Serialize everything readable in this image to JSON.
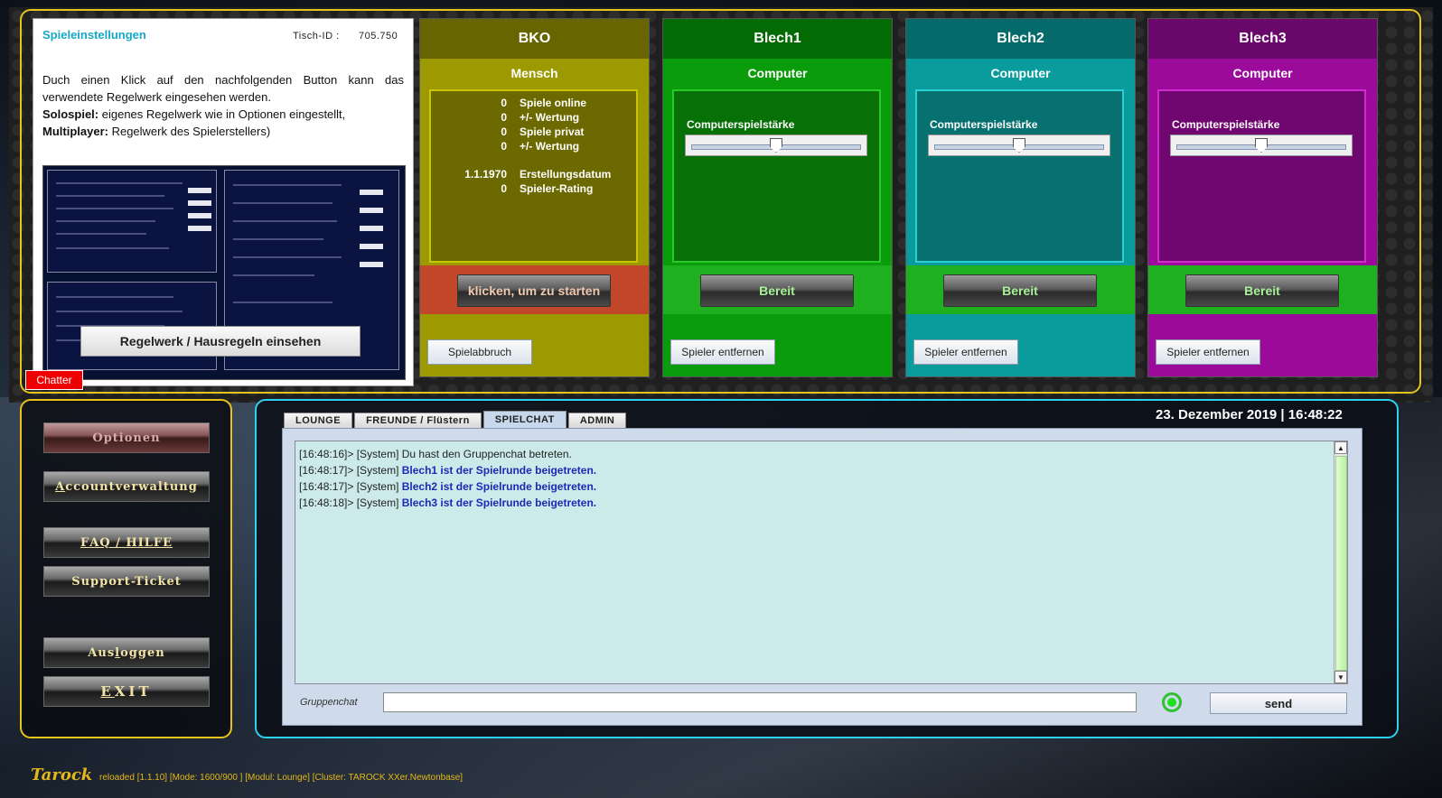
{
  "settings": {
    "title": "Spieleinstellungen",
    "tisch_label": "Tisch-ID :",
    "tisch_id": "705.750",
    "desc_1": "Duch einen Klick auf den nachfolgenden Button kann das verwendete Regelwerk eingesehen werden.",
    "solo_label": "Solospiel:",
    "solo_text": " eigenes Regelwerk wie in Optionen eingestellt,",
    "multi_label": "Multiplayer:",
    "multi_text": " Regelwerk des Spielerstellers)",
    "regel_button": "Regelwerk / Hausregeln einsehen"
  },
  "chatter_label": "Chatter",
  "players": [
    {
      "name": "BKO",
      "type": "Mensch",
      "stats": [
        {
          "value": "0",
          "label": "Spiele online"
        },
        {
          "value": "0",
          "label": "+/- Wertung"
        },
        {
          "value": "0",
          "label": "Spiele privat"
        },
        {
          "value": "0",
          "label": "+/- Wertung"
        },
        {
          "value": "1.1.1970",
          "label": "Erstellungsdatum"
        },
        {
          "value": "0",
          "label": "Spieler-Rating"
        }
      ],
      "action_button": "klicken, um zu starten",
      "bottom_button": "Spielabbruch",
      "colors": {
        "bg": "#9c9a00",
        "head": "#676500",
        "inner": "#6b6900",
        "inner_border": "#c8c600",
        "band": "#c2462a",
        "btntext": "#f0c8b0"
      }
    },
    {
      "name": "Blech1",
      "type": "Computer",
      "strength_label": "Computerspielstärke",
      "action_button": "Bereit",
      "bottom_button": "Spieler entfernen",
      "colors": {
        "bg": "#0b9c0b",
        "head": "#046a04",
        "inner": "#077007",
        "inner_border": "#28c828",
        "band": "#1fb01f",
        "btntext": "#a8f098"
      }
    },
    {
      "name": "Blech2",
      "type": "Computer",
      "strength_label": "Computerspielstärke",
      "action_button": "Bereit",
      "bottom_button": "Spieler entfernen",
      "colors": {
        "bg": "#0a9c9c",
        "head": "#076a6a",
        "inner": "#077070",
        "inner_border": "#2ad0d0",
        "band": "#1fb01f",
        "btntext": "#a8f098"
      }
    },
    {
      "name": "Blech3",
      "type": "Computer",
      "strength_label": "Computerspielstärke",
      "action_button": "Bereit",
      "bottom_button": "Spieler entfernen",
      "colors": {
        "bg": "#9c0a9c",
        "head": "#6a076a",
        "inner": "#700770",
        "inner_border": "#d02ad0",
        "band": "#1fb01f",
        "btntext": "#a8f098"
      }
    }
  ],
  "menu": {
    "optionen": "Optionen",
    "account_first": "A",
    "account_rest": "ccountverwaltung",
    "faq_first": "F",
    "faq_rest": "AQ / HILFE",
    "support": "Support-Ticket",
    "logout_a": "Aus",
    "logout_l": "l",
    "logout_b": "oggen",
    "exit_first": "E",
    "exit_rest": "XIT"
  },
  "chat": {
    "tabs": [
      "LOUNGE",
      "FREUNDE  / Flüstern",
      "SPIELCHAT",
      "ADMIN"
    ],
    "active_tab": "SPIELCHAT",
    "datetime": "23. Dezember 2019 | 16:48:22",
    "messages": [
      {
        "time": "[16:48:16]>",
        "src": " [System] ",
        "text": "Du hast den Gruppenchat betreten.",
        "bold": false
      },
      {
        "time": "[16:48:17]>",
        "src": " [System] ",
        "text": "Blech1 ist der Spielrunde beigetreten.",
        "bold": true
      },
      {
        "time": "[16:48:17]>",
        "src": " [System] ",
        "text": "Blech2 ist der Spielrunde beigetreten.",
        "bold": true
      },
      {
        "time": "[16:48:18]>",
        "src": " [System] ",
        "text": "Blech3 ist der Spielrunde beigetreten.",
        "bold": true
      }
    ],
    "input_label": "Gruppenchat",
    "input_value": "",
    "send_label": "send"
  },
  "footer": {
    "logo": "Tarock",
    "text": "reloaded [1.1.10] [Mode: 1600/900 ] [Modul: Lounge] [Cluster: TAROCK XXer.Newtonbase]"
  },
  "icons": {
    "online_status": "online-status-icon",
    "scroll_up": "arrow-up-icon",
    "scroll_down": "arrow-down-icon"
  }
}
